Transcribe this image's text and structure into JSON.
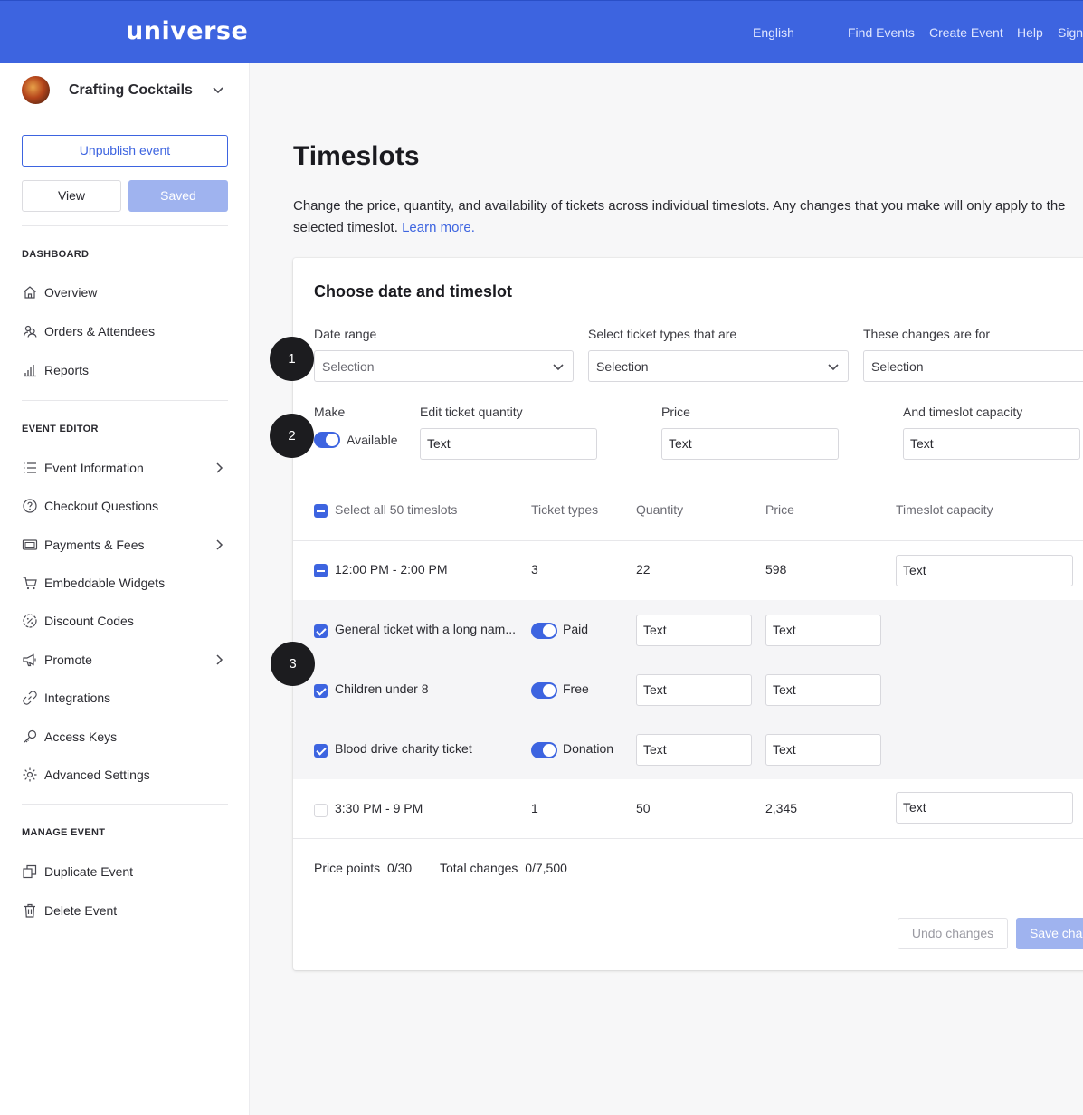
{
  "header": {
    "logo": "universe",
    "nav": [
      "English",
      "Find Events",
      "Create Event",
      "Help",
      "Sign"
    ]
  },
  "sidebar": {
    "event_name": "Crafting Cocktails",
    "unpublish_label": "Unpublish event",
    "view_label": "View",
    "saved_label": "Saved",
    "sections": {
      "dashboard": "DASHBOARD",
      "event_editor": "EVENT EDITOR",
      "manage_event": "MANAGE EVENT"
    },
    "dashboard_items": [
      "Overview",
      "Orders & Attendees",
      "Reports"
    ],
    "editor_items": [
      "Event Information",
      "Checkout Questions",
      "Payments & Fees",
      "Embeddable Widgets",
      "Discount Codes",
      "Promote",
      "Integrations",
      "Access Keys",
      "Advanced Settings"
    ],
    "manage_items": [
      "Duplicate Event",
      "Delete Event"
    ]
  },
  "main": {
    "title": "Timeslots",
    "description": "Change the price, quantity, and availability of tickets across individual timeslots. Any changes that you make will only apply to the selected timeslot.",
    "learn_more": "Learn more."
  },
  "card": {
    "title": "Choose date and timeslot",
    "date_range_label": "Date range",
    "date_range_value": "Selection",
    "ticket_types_label": "Select ticket types that are",
    "ticket_types_value": "Selection",
    "changes_for_label": "These changes are for",
    "changes_for_value": "Selection",
    "make_label": "Make",
    "available_label": "Available",
    "edit_qty_label": "Edit ticket quantity",
    "edit_qty_value": "Text",
    "price_label": "Price",
    "price_value": "Text",
    "capacity_label": "And timeslot capacity",
    "capacity_value": "Text"
  },
  "table": {
    "headers": {
      "select_all": "Select all 50 timeslots",
      "ticket_types": "Ticket types",
      "quantity": "Quantity",
      "price": "Price",
      "capacity": "Timeslot capacity"
    },
    "timeslots": [
      {
        "time": "12:00 PM - 2:00 PM",
        "ticket_types": "3",
        "quantity": "22",
        "price": "598",
        "capacity": "Text"
      },
      {
        "time": "3:30 PM - 9 PM",
        "ticket_types": "1",
        "quantity": "50",
        "price": "2,345",
        "capacity": "Text"
      }
    ],
    "tickets": [
      {
        "name": "General ticket with a long nam...",
        "kind": "Paid",
        "quantity": "Text",
        "price": "Text"
      },
      {
        "name": "Children under 8",
        "kind": "Free",
        "quantity": "Text",
        "price": "Text"
      },
      {
        "name": "Blood drive charity ticket",
        "kind": "Donation",
        "quantity": "Text",
        "price": "Text"
      }
    ]
  },
  "footer": {
    "price_points_label": "Price points",
    "price_points_value": "0/30",
    "total_changes_label": "Total changes",
    "total_changes_value": "0/7,500",
    "undo_label": "Undo changes",
    "save_label": "Save changes"
  },
  "markers": [
    "1",
    "2",
    "3"
  ],
  "colors": {
    "brand": "#3d64e0",
    "brand_disabled": "#9fb3ef",
    "row_highlight": "#f5f5f7"
  }
}
